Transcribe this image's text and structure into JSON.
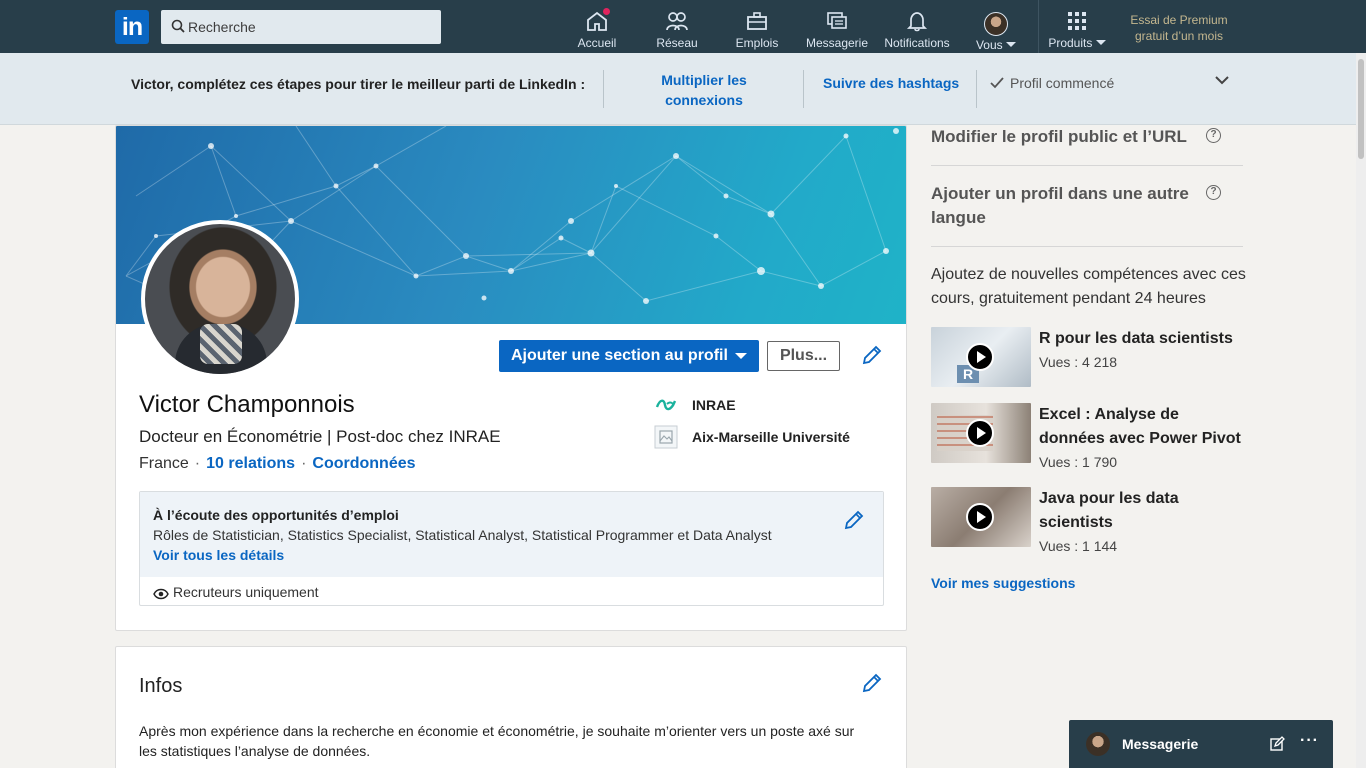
{
  "nav": {
    "logo": "in",
    "search_placeholder": "Recherche",
    "items": [
      {
        "label": "Accueil"
      },
      {
        "label": "Réseau"
      },
      {
        "label": "Emplois"
      },
      {
        "label": "Messagerie"
      },
      {
        "label": "Notifications"
      },
      {
        "label": "Vous"
      },
      {
        "label": "Produits"
      }
    ],
    "premium": "Essai de Premium gratuit d’un mois"
  },
  "steps": {
    "intro": "Victor, complétez ces étapes pour tirer le meilleur parti de LinkedIn :",
    "link1_line1": "Multiplier les",
    "link1_line2": "connexions",
    "link2": "Suivre des hashtags",
    "done": "Profil commencé"
  },
  "profile": {
    "add_section": "Ajouter une section au profil",
    "more": "Plus...",
    "name": "Victor Champonnois",
    "headline": "Docteur en Économétrie | Post-doc chez INRAE",
    "location": "France",
    "relations": "10 relations",
    "contact": "Coordonnées",
    "org1": "INRAE",
    "org2": "Aix-Marseille Université",
    "opportunities": {
      "title": "À l’écoute des opportunités d’emploi",
      "roles": "Rôles de Statistician, Statistics Specialist, Statistical Analyst, Statistical Programmer et Data Analyst",
      "details": "Voir tous les détails",
      "visibility": "Recruteurs uniquement"
    }
  },
  "infos": {
    "title": "Infos",
    "text_line1": "Après mon expérience dans la recherche en économie et économétrie, je souhaite m’orienter vers un poste axé sur",
    "text_line2": "les statistiques l’analyse de données."
  },
  "rail": {
    "public_profile": "Modifier le profil public et l’URL",
    "other_language": "Ajouter un profil dans une autre langue",
    "promo": "Ajoutez de nouvelles compétences avec ces cours, gratuitement pendant 24 heures",
    "courses": [
      {
        "title": "R pour les data scientists",
        "views": "Vues : 4 218"
      },
      {
        "title": "Excel : Analyse de données avec Power Pivot",
        "views": "Vues : 1 790"
      },
      {
        "title": "Java pour les data scientists",
        "views": "Vues : 1 144"
      }
    ],
    "suggestions": "Voir mes suggestions"
  },
  "messaging": {
    "label": "Messagerie"
  },
  "colors": {
    "nav_bg": "#283e4a",
    "accent": "#0a66c2",
    "page_bg": "#f3f2ef"
  }
}
